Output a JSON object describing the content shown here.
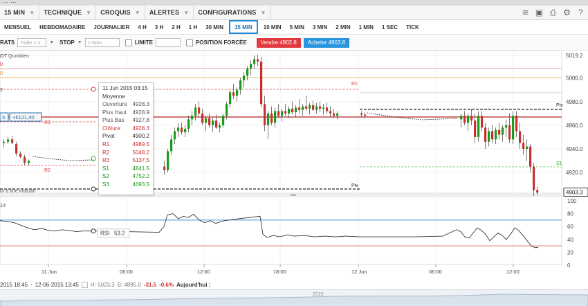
{
  "window": {
    "title": "... ..."
  },
  "menu": [
    {
      "label": "15 MIN",
      "dropdown": true
    },
    {
      "label": "TECHNIQUE",
      "dropdown": true
    },
    {
      "label": "CROQUIS",
      "dropdown": true
    },
    {
      "label": "ALERTES",
      "dropdown": true
    },
    {
      "label": "CONFIGURATIONS",
      "dropdown": true
    }
  ],
  "toolbar_icons": [
    "layers-icon",
    "image-icon",
    "print-icon",
    "settings-icon",
    "help-icon"
  ],
  "timeframes": [
    "MENSUEL",
    "HEBDOMADAIRE",
    "JOURNALIER",
    "4 H",
    "3 H",
    "2 H",
    "1 H",
    "30 MIN",
    "15 MIN",
    "10 MIN",
    "5 MIN",
    "3 MIN",
    "2 MIN",
    "1 MIN",
    "1 SEC",
    "TICK"
  ],
  "active_timeframe": "15 MIN",
  "order": {
    "label_left": "RATS",
    "taille_placeholder": "Taille ≥ 2",
    "stop_label": "STOP",
    "stop_placeholder": "≥ 9pts",
    "limite_label": "LIMITE",
    "position_label": "POSITION FORCÉE",
    "sell_label": "Vendre 4902.8",
    "buy_label": "Acheter 4903.8"
  },
  "chart": {
    "instrument_label": "OT",
    "period_label": "Quotidien",
    "left_labels": [
      "0",
      "0",
      "2"
    ],
    "position_labels": [
      ".5",
      "+€121,40"
    ],
    "disclaimer": "ur à titre indicatif",
    "price_axis": [
      "5019.2",
      "5000.0",
      "4980.0",
      "4960.0",
      "4940.0",
      "4920.0"
    ],
    "current_price": "4903.3",
    "rsi_axis": [
      "100",
      "80",
      "60",
      "40",
      "20",
      "0"
    ],
    "rsi_panel_label": "14",
    "rsi_label": "RSI",
    "rsi_value": "53.2",
    "pivot_labels": {
      "r1": "R1",
      "r2": "R2",
      "r3": "R3",
      "piv": "Piv",
      "s1": "S1"
    },
    "time_axis": [
      "11 Jun",
      "06:00",
      "12:00",
      "18:00",
      "12 Jun",
      "06:00",
      "12:00"
    ]
  },
  "tooltip": {
    "date": "11 Jun 2015 03:15",
    "subtitle": "Moyenne",
    "rows": [
      {
        "label": "Ouverture",
        "value": "4928.3",
        "color": "#555555"
      },
      {
        "label": "Plus Haut",
        "value": "4928.9",
        "color": "#555555"
      },
      {
        "label": "Plus Bas",
        "value": "4927.8",
        "color": "#555555"
      },
      {
        "label": "Clôture",
        "value": "4928.3",
        "color": "#d22c2c"
      },
      {
        "label": "Pivot",
        "value": "4900.2",
        "color": "#333333"
      },
      {
        "label": "R1",
        "value": "4989.5",
        "color": "#d22c2c"
      },
      {
        "label": "R2",
        "value": "5048.2",
        "color": "#d22c2c"
      },
      {
        "label": "R3",
        "value": "5137.5",
        "color": "#d22c2c"
      },
      {
        "label": "S1",
        "value": "4841.5",
        "color": "#1a9b1a"
      },
      {
        "label": "S2",
        "value": "4752.2",
        "color": "#1a9b1a"
      },
      {
        "label": "S3",
        "value": "4693.5",
        "color": "#1a9b1a"
      }
    ]
  },
  "status": {
    "range_from": "2015 18:45",
    "range_to": "12-06-2015 13:45",
    "h_label": "H: 5023.3",
    "b_label": "B: 4895.0",
    "change_pts": "-31.5",
    "change_pct": "-0.6%",
    "today_label": "Aujourd'hui :"
  },
  "navigator_labels": [
    "2015"
  ],
  "colors": {
    "up": "#1a9b1a",
    "down": "#c83030",
    "accent": "#1e8bd6",
    "sell": "#e2393e",
    "buy": "#2a95df"
  }
}
